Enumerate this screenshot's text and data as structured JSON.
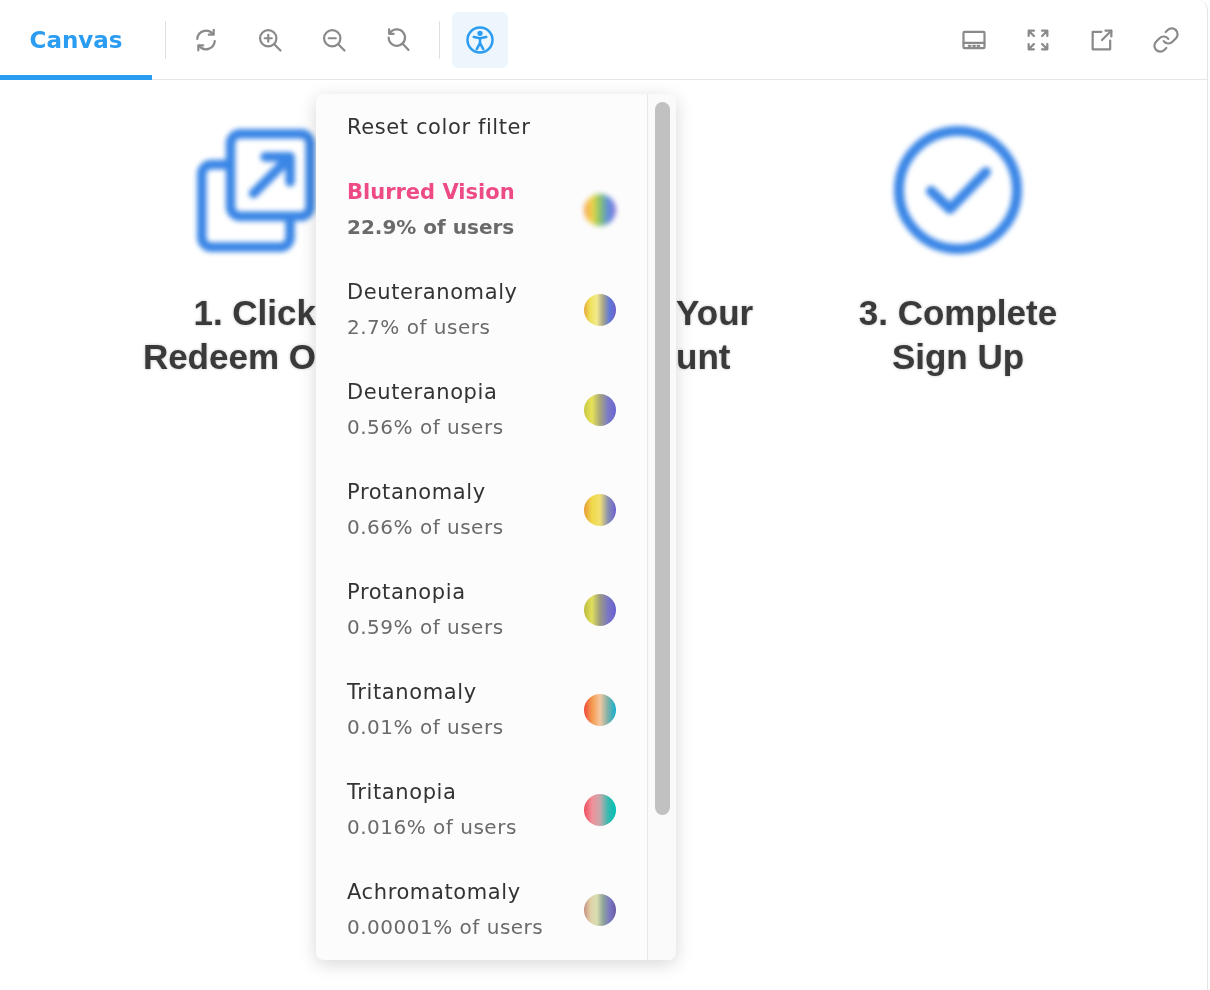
{
  "tabs": [
    {
      "label": "Canvas",
      "selected": true
    }
  ],
  "toolbar": {
    "tool_groups": [
      [
        {
          "kind": "refresh",
          "selected": false
        },
        {
          "kind": "zoom_in",
          "selected": false
        },
        {
          "kind": "zoom_out",
          "selected": false
        },
        {
          "kind": "reset_zoom",
          "selected": false
        }
      ],
      [
        {
          "kind": "accessibility",
          "selected": true
        }
      ]
    ],
    "view_tools": [
      {
        "kind": "panel"
      },
      {
        "kind": "fullscreen"
      },
      {
        "kind": "external"
      },
      {
        "kind": "link"
      }
    ]
  },
  "canvas": {
    "steps": [
      {
        "kind": "squares_arrow",
        "title_lines": [
          "1. Click",
          "Redeem O"
        ]
      },
      {
        "kind": "text_only",
        "title_lines": [
          "Your",
          "unt"
        ]
      },
      {
        "kind": "check_circle",
        "title_lines": [
          "3. Complete",
          "Sign Up"
        ]
      }
    ]
  },
  "color_filter_menu": {
    "items": [
      {
        "kind": "reset",
        "label": "Reset color filter",
        "selected": false
      },
      {
        "kind": "blur",
        "label": "Blurred Vision",
        "share": "22.9% of users",
        "selected": true
      },
      {
        "kind": "deuteranomaly",
        "label": "Deuteranomaly",
        "share": "2.7% of users",
        "selected": false
      },
      {
        "kind": "deuteranopia",
        "label": "Deuteranopia",
        "share": "0.56% of users",
        "selected": false
      },
      {
        "kind": "protanomaly",
        "label": "Protanomaly",
        "share": "0.66% of users",
        "selected": false
      },
      {
        "kind": "protanopia",
        "label": "Protanopia",
        "share": "0.59% of users",
        "selected": false
      },
      {
        "kind": "tritanomaly",
        "label": "Tritanomaly",
        "share": "0.01% of users",
        "selected": false
      },
      {
        "kind": "tritanopia",
        "label": "Tritanopia",
        "share": "0.016% of users",
        "selected": false
      },
      {
        "kind": "achromatomaly",
        "label": "Achromatomaly",
        "share": "0.00001% of users",
        "selected": false
      }
    ]
  }
}
